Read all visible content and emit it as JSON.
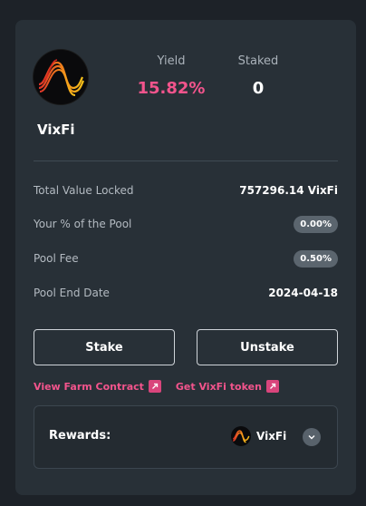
{
  "pool": {
    "token_name": "VixFi",
    "logo_icon": "vixfi-wave-logo-icon"
  },
  "stats": {
    "yield_label": "Yield",
    "yield_value": "15.82%",
    "staked_label": "Staked",
    "staked_value": "0"
  },
  "details": [
    {
      "label": "Total Value Locked",
      "value": "757296.14 VixFi"
    },
    {
      "label": "Your % of the Pool",
      "value": "0.00%"
    },
    {
      "label": "Pool Fee",
      "value": "0.50%"
    },
    {
      "label": "Pool End Date",
      "value": "2024-04-18"
    }
  ],
  "actions": {
    "stake_label": "Stake",
    "unstake_label": "Unstake"
  },
  "links": {
    "farm_contract": "View Farm Contract",
    "get_token": "Get VixFi token"
  },
  "rewards": {
    "label": "Rewards:",
    "token": "VixFi"
  },
  "colors": {
    "accent": "#f2548c",
    "card": "#283037",
    "background": "#1d2228"
  }
}
